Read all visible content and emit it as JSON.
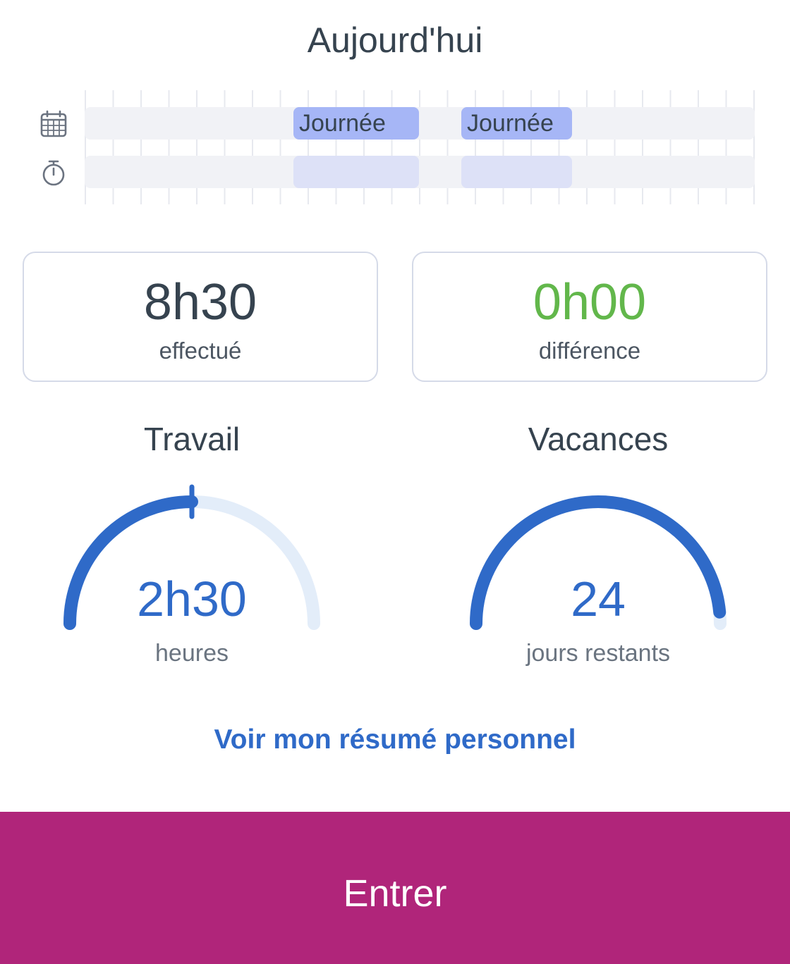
{
  "header": {
    "title": "Aujourd'hui"
  },
  "timeline": {
    "rows": [
      {
        "icon": "calendar-icon"
      },
      {
        "icon": "stopwatch-icon"
      }
    ],
    "planned_blocks": [
      {
        "label": "Journée"
      },
      {
        "label": "Journée"
      }
    ],
    "colors": {
      "planned": "#a6b6f6",
      "actual": "#dde1f7",
      "track": "#f1f2f6"
    }
  },
  "stats": {
    "done": {
      "value": "8h30",
      "label": "effectué"
    },
    "difference": {
      "value": "0h00",
      "label": "différence",
      "color": "#62b74b"
    }
  },
  "gauges": {
    "work": {
      "title": "Travail",
      "value": "2h30",
      "unit_label": "heures",
      "fill_fraction": 0.5
    },
    "vacation": {
      "title": "Vacances",
      "value": "24",
      "unit_label": "jours restants",
      "fill_fraction": 0.97
    },
    "colors": {
      "fill": "#2f6ac8",
      "track": "#e3edf9"
    }
  },
  "links": {
    "summary": "Voir mon résumé personnel"
  },
  "actions": {
    "enter": "Entrer",
    "enter_color": "#b0257a"
  }
}
